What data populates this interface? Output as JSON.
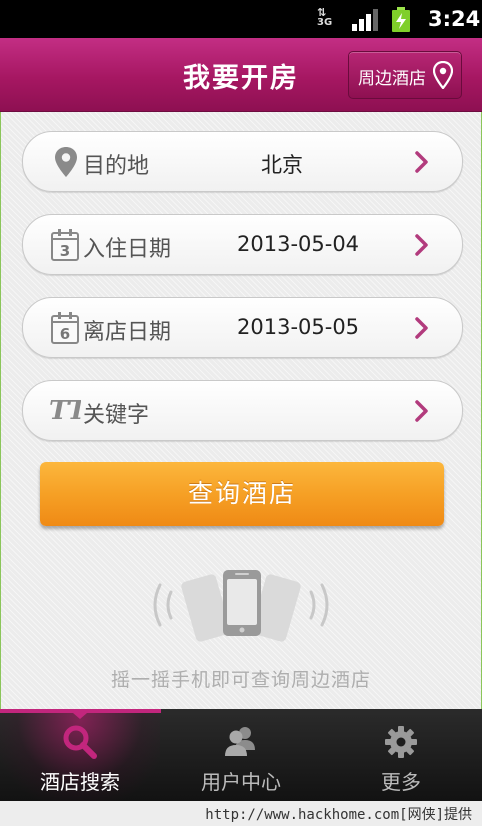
{
  "status_bar": {
    "network": "3G",
    "time": "3:24"
  },
  "header": {
    "title": "我要开房",
    "nearby_button": "周边酒店"
  },
  "form": {
    "destination": {
      "label": "目的地",
      "value": "北京",
      "icon": "location-pin-icon"
    },
    "checkin": {
      "label": "入住日期",
      "value": "2013-05-04",
      "calendar_day": "3",
      "icon": "calendar-icon"
    },
    "checkout": {
      "label": "离店日期",
      "value": "2013-05-05",
      "calendar_day": "6",
      "icon": "calendar-icon"
    },
    "keyword": {
      "label": "关键字",
      "icon_text": "TT",
      "icon": "text-icon"
    }
  },
  "search_button": "查询酒店",
  "shake_hint": "摇一摇手机即可查询周边酒店",
  "tabs": [
    {
      "label": "酒店搜索",
      "icon": "search-icon",
      "active": true
    },
    {
      "label": "用户中心",
      "icon": "users-icon",
      "active": false
    },
    {
      "label": "更多",
      "icon": "gear-icon",
      "active": false
    }
  ],
  "watermark": "http://www.hackhome.com[网侠]提供",
  "colors": {
    "brand": "#a61762",
    "accent": "#f6a025",
    "tab_active": "#c2267d"
  }
}
